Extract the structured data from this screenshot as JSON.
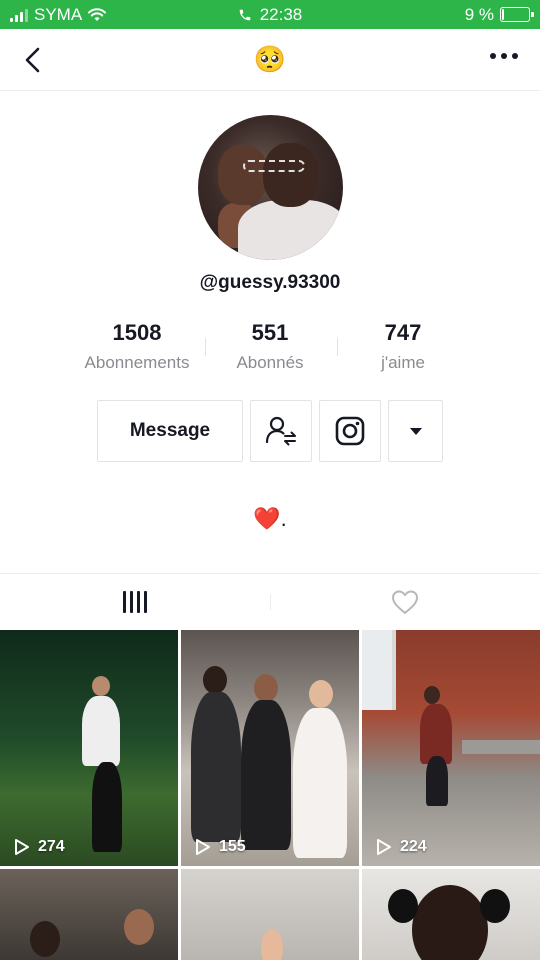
{
  "status_bar": {
    "carrier": "SYMA",
    "time": "22:38",
    "battery_text": "9 %",
    "battery_level": 0.09,
    "background_color": "#2eb54a"
  },
  "nav": {
    "title": "🥺",
    "back_icon": "chevron-left-icon",
    "more_icon": "more-horizontal-icon"
  },
  "profile": {
    "username": "@guessy.93300",
    "stats": [
      {
        "value": "1508",
        "label": "Abonnements"
      },
      {
        "value": "551",
        "label": "Abonnés"
      },
      {
        "value": "747",
        "label": "j'aime"
      }
    ],
    "message_button": "Message",
    "bio": "❤️."
  },
  "tabs": [
    {
      "name": "videos",
      "icon": "grid-icon",
      "active": true
    },
    {
      "name": "liked",
      "icon": "heart-outline-icon",
      "active": false
    }
  ],
  "videos": [
    {
      "views": "274"
    },
    {
      "views": "155"
    },
    {
      "views": "224"
    }
  ]
}
